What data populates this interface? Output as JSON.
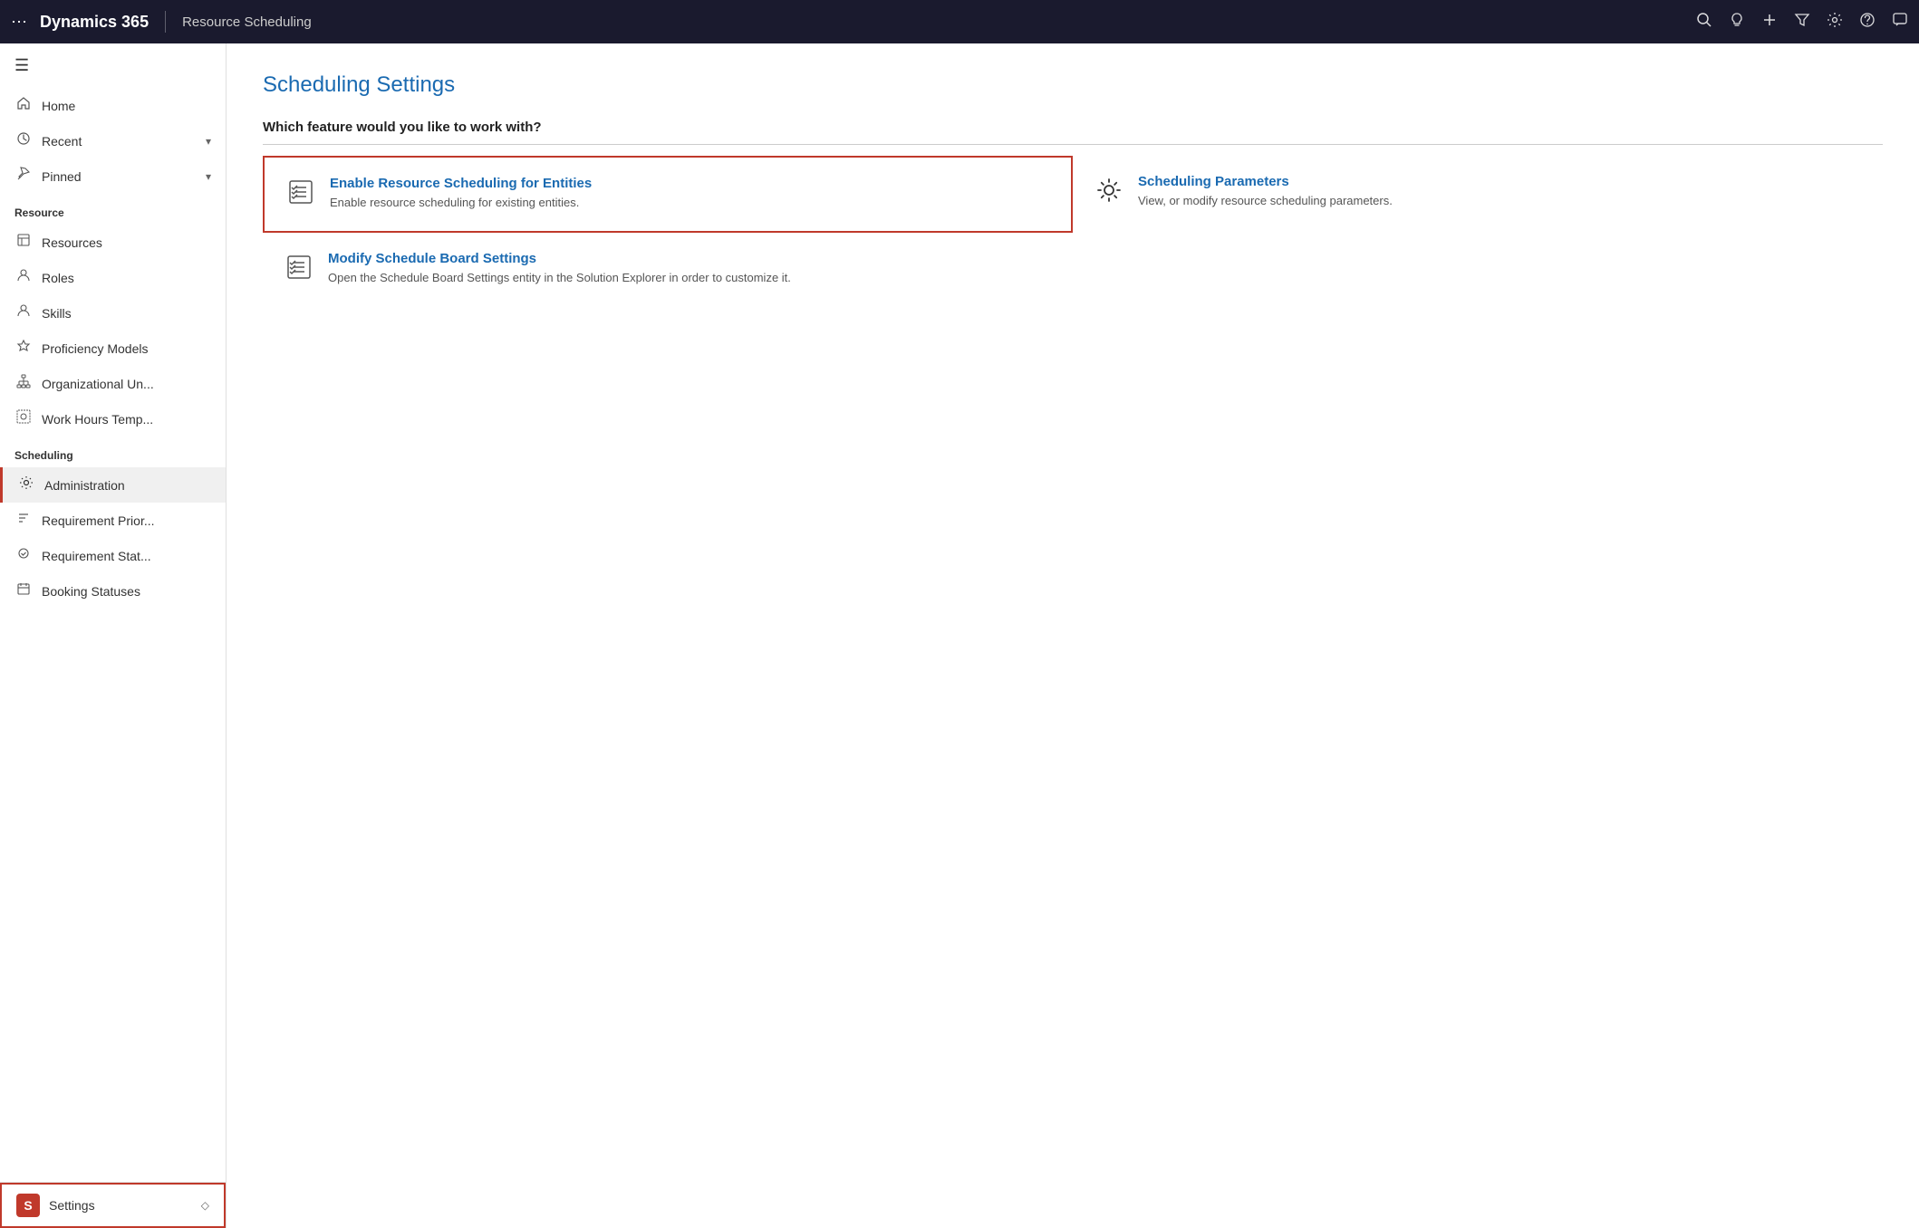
{
  "topbar": {
    "brand": "Dynamics 365",
    "module": "Resource Scheduling",
    "icons": [
      "search",
      "bulb",
      "plus",
      "filter",
      "gear",
      "question",
      "chat"
    ]
  },
  "sidebar": {
    "menu_icon": "☰",
    "nav_items": [
      {
        "id": "home",
        "label": "Home",
        "icon": "⌂"
      },
      {
        "id": "recent",
        "label": "Recent",
        "icon": "🕐",
        "has_chevron": true
      },
      {
        "id": "pinned",
        "label": "Pinned",
        "icon": "☆",
        "has_chevron": true
      }
    ],
    "resource_section": "Resource",
    "resource_items": [
      {
        "id": "resources",
        "label": "Resources",
        "icon": "res"
      },
      {
        "id": "roles",
        "label": "Roles",
        "icon": "rol"
      },
      {
        "id": "skills",
        "label": "Skills",
        "icon": "ski"
      },
      {
        "id": "proficiency",
        "label": "Proficiency Models",
        "icon": "pro"
      },
      {
        "id": "org-units",
        "label": "Organizational Un...",
        "icon": "org"
      },
      {
        "id": "work-hours",
        "label": "Work Hours Temp...",
        "icon": "wht"
      }
    ],
    "scheduling_section": "Scheduling",
    "scheduling_items": [
      {
        "id": "administration",
        "label": "Administration",
        "icon": "⚙",
        "active": true
      },
      {
        "id": "req-priority",
        "label": "Requirement Prior...",
        "icon": "rp"
      },
      {
        "id": "req-status",
        "label": "Requirement Stat...",
        "icon": "rs"
      },
      {
        "id": "booking-statuses",
        "label": "Booking Statuses",
        "icon": "bs"
      }
    ],
    "settings": {
      "letter": "S",
      "label": "Settings",
      "chevron": "◇"
    }
  },
  "content": {
    "page_title": "Scheduling Settings",
    "section_question": "Which feature would you like to work with?",
    "feature_cards": [
      {
        "id": "enable-resource-scheduling",
        "title": "Enable Resource Scheduling for Entities",
        "description": "Enable resource scheduling for existing entities.",
        "highlighted": true
      },
      {
        "id": "scheduling-parameters",
        "title": "Scheduling Parameters",
        "description": "View, or modify resource scheduling parameters.",
        "highlighted": false
      },
      {
        "id": "modify-schedule-board",
        "title": "Modify Schedule Board Settings",
        "description": "Open the Schedule Board Settings entity in the Solution Explorer in order to customize it.",
        "highlighted": false
      }
    ]
  }
}
